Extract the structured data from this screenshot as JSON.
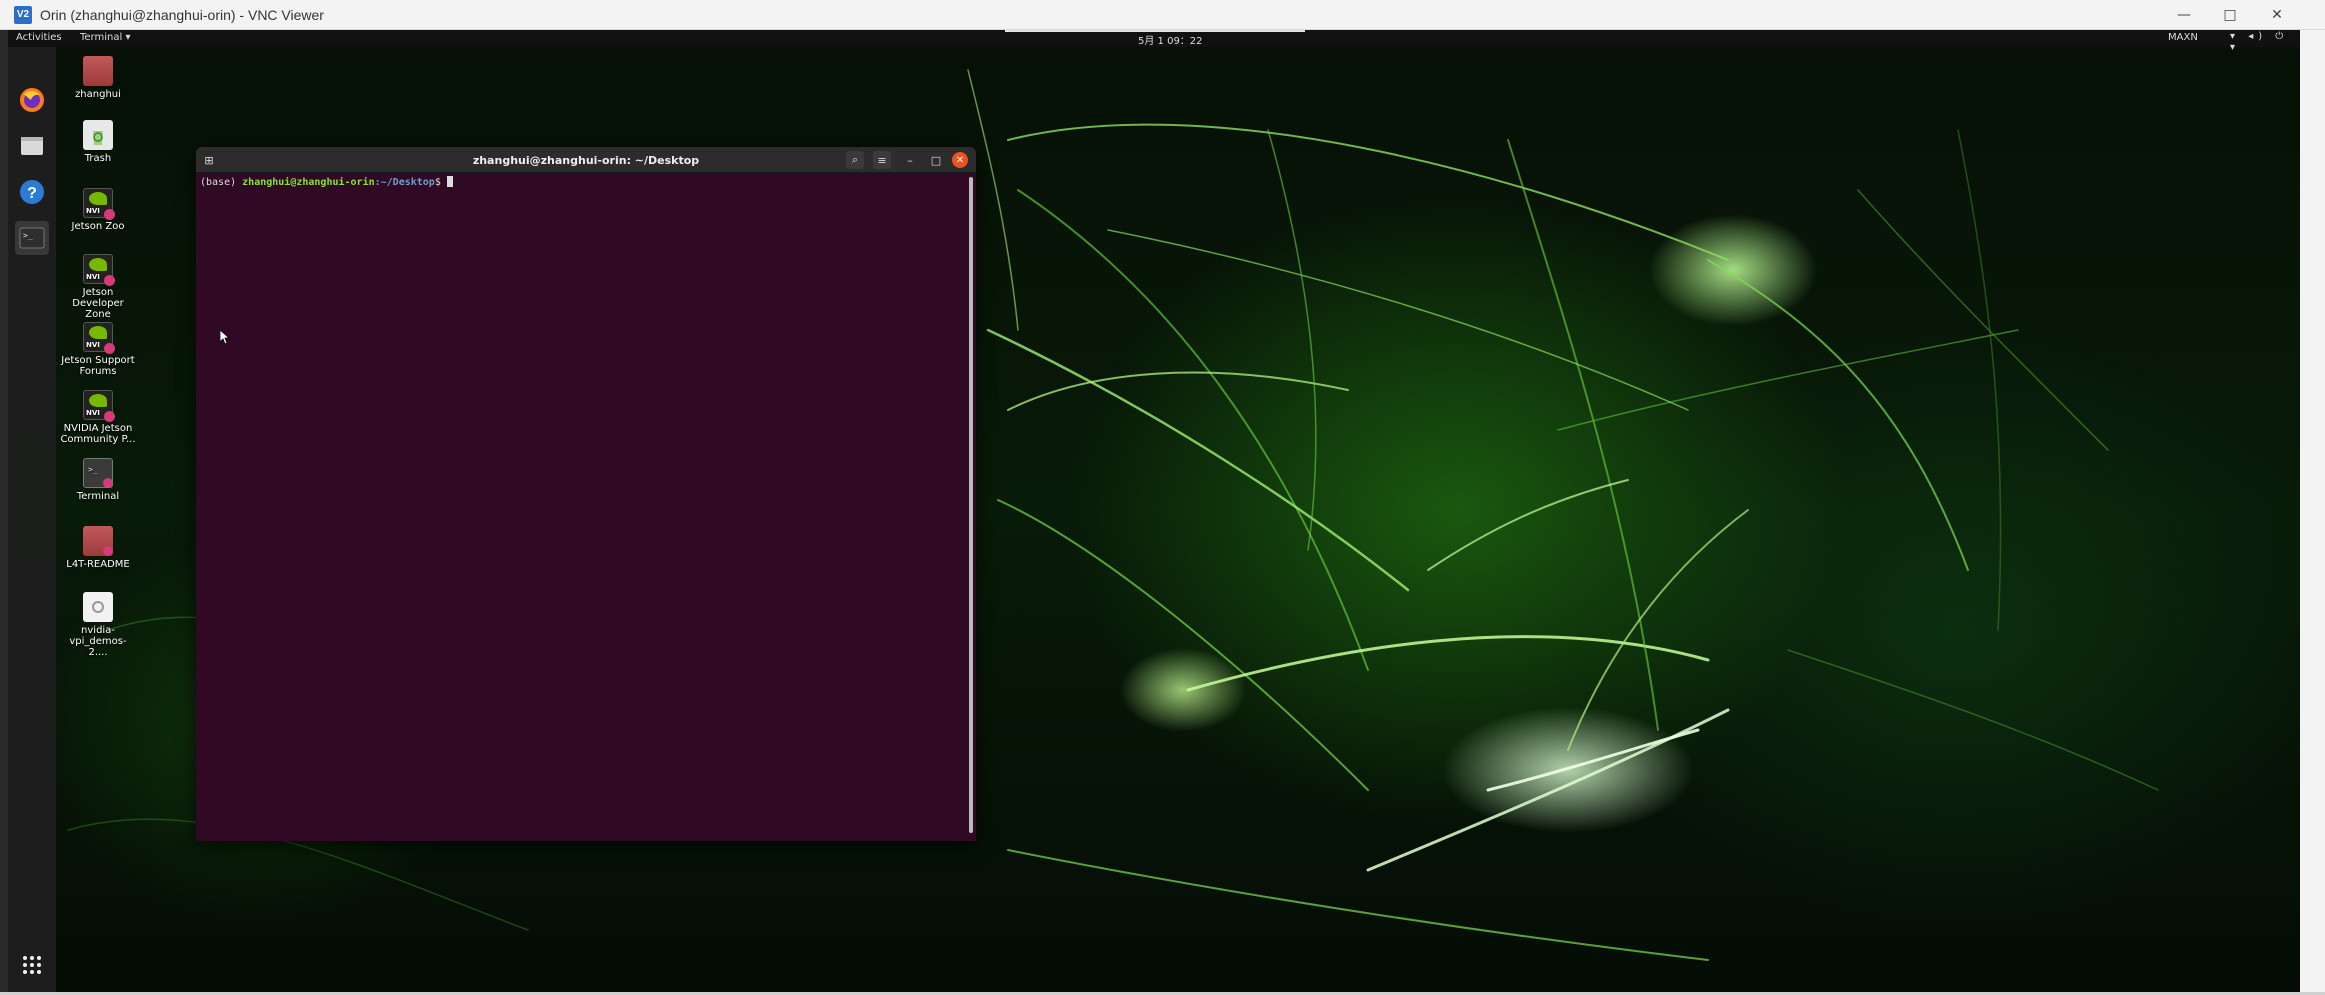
{
  "vnc": {
    "logo": "V2",
    "title": "Orin (zhanghui@zhanghui-orin) - VNC Viewer",
    "minimize_icon": "minimize-icon",
    "maximize_icon": "maximize-icon",
    "close_icon": "close-icon"
  },
  "topbar": {
    "activities": "Activities",
    "app_menu": "Terminal ▾",
    "clock": "5月 1 09：22",
    "power_mode": "MAXN",
    "tray": "▾ ◂) ⏻ ▾"
  },
  "dock": {
    "items": [
      "firefox-icon",
      "files-icon",
      "help-icon",
      "terminal-icon",
      "show-apps-icon"
    ]
  },
  "desktop_icons": [
    {
      "label": "zhanghui",
      "icon": "home-folder-icon"
    },
    {
      "label": "Trash",
      "icon": "trash-icon"
    },
    {
      "label": "Jetson Zoo",
      "icon": "nvidia-link-icon"
    },
    {
      "label": "Jetson Developer Zone",
      "icon": "nvidia-link-icon"
    },
    {
      "label": "Jetson Support Forums",
      "icon": "nvidia-link-icon"
    },
    {
      "label": "NVIDIA Jetson Community P...",
      "icon": "nvidia-link-icon"
    },
    {
      "label": "Terminal",
      "icon": "terminal-shortcut-icon"
    },
    {
      "label": "L4T-README",
      "icon": "folder-link-icon"
    },
    {
      "label": "nvidia-vpi_demos-2....",
      "icon": "package-icon"
    }
  ],
  "terminal": {
    "title": "zhanghui@zhanghui-orin: ~/Desktop",
    "env": "(base)",
    "user_host": "zhanghui@zhanghui-orin",
    "path": ":~/Desktop",
    "dollar": "$",
    "nvidia_badge": "NVI"
  },
  "colors": {
    "terminal_bg": "#300a24",
    "prompt_green": "#8ae234",
    "prompt_blue": "#729fcf",
    "close_orange": "#e95420",
    "nvidia_green": "#76b900"
  }
}
